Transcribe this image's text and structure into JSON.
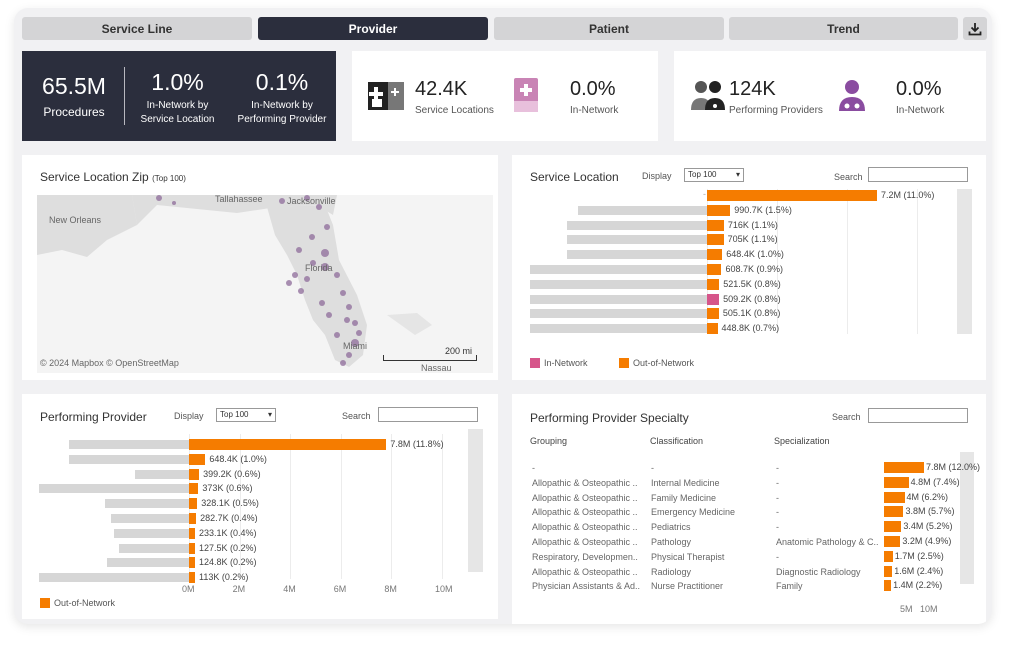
{
  "tabs": [
    {
      "label": "Service Line",
      "active": false
    },
    {
      "label": "Provider",
      "active": true
    },
    {
      "label": "Patient",
      "active": false
    },
    {
      "label": "Trend",
      "active": false
    }
  ],
  "kpi_main": {
    "procedures_value": "65.5M",
    "procedures_label": "Procedures",
    "in_network_svc_value": "1.0%",
    "in_network_svc_label1": "In-Network by",
    "in_network_svc_label2": "Service Location",
    "in_network_prov_value": "0.1%",
    "in_network_prov_label1": "In-Network by",
    "in_network_prov_label2": "Performing Provider"
  },
  "kpi_locations": {
    "value": "42.4K",
    "label": "Service Locations",
    "in_network_value": "0.0%",
    "in_network_label": "In-Network"
  },
  "kpi_providers": {
    "value": "124K",
    "label": "Performing Providers",
    "in_network_value": "0.0%",
    "in_network_label": "In-Network"
  },
  "map_panel": {
    "title": "Service Location Zip",
    "title_small": "(Top 100)",
    "labels": {
      "new_orleans": "New Orleans",
      "tallahassee": "Tallahassee",
      "jacksonville": "Jacksonville",
      "florida": "Florida",
      "miami": "Miami",
      "nassau": "Nassau"
    },
    "scale": "200 mi",
    "attribution": "© 2024 Mapbox  © OpenStreetMap"
  },
  "service_location": {
    "title": "Service Location",
    "display_label": "Display",
    "display_value": "Top 100",
    "search_label": "Search",
    "rows": [
      {
        "label": "7.2M (11.0%)",
        "gray": 0,
        "orange": 1.0,
        "in_network": false
      },
      {
        "label": "990.7K (1.5%)",
        "gray": 0.73,
        "orange": 0.137,
        "in_network": false
      },
      {
        "label": "716K (1.1%)",
        "gray": 0.79,
        "orange": 0.099,
        "in_network": false
      },
      {
        "label": "705K (1.1%)",
        "gray": 0.79,
        "orange": 0.098,
        "in_network": false
      },
      {
        "label": "648.4K (1.0%)",
        "gray": 0.79,
        "orange": 0.09,
        "in_network": false
      },
      {
        "label": "608.7K (0.9%)",
        "gray": 1.0,
        "orange": 0.085,
        "in_network": false
      },
      {
        "label": "521.5K (0.8%)",
        "gray": 1.0,
        "orange": 0.072,
        "in_network": false
      },
      {
        "label": "509.2K (0.8%)",
        "gray": 1.0,
        "orange": 0.071,
        "in_network": true
      },
      {
        "label": "505.1K (0.8%)",
        "gray": 1.0,
        "orange": 0.07,
        "in_network": false
      },
      {
        "label": "448.8K (0.7%)",
        "gray": 1.0,
        "orange": 0.062,
        "in_network": false
      }
    ],
    "legend": [
      {
        "label": "In-Network",
        "color": "#d6558a"
      },
      {
        "label": "Out-of-Network",
        "color": "#f57c00"
      }
    ]
  },
  "performing_provider": {
    "title": "Performing Provider",
    "display_label": "Display",
    "display_value": "Top 100",
    "search_label": "Search",
    "rows": [
      {
        "label": "7.8M (11.8%)",
        "value": 7.8,
        "gray": 0.8
      },
      {
        "label": "648.4K (1.0%)",
        "value": 0.6484,
        "gray": 0.8
      },
      {
        "label": "399.2K (0.6%)",
        "value": 0.3992,
        "gray": 0.36
      },
      {
        "label": "373K (0.6%)",
        "value": 0.373,
        "gray": 1.0
      },
      {
        "label": "328.1K (0.5%)",
        "value": 0.3281,
        "gray": 0.56
      },
      {
        "label": "282.7K (0.4%)",
        "value": 0.2827,
        "gray": 0.52
      },
      {
        "label": "233.1K (0.4%)",
        "value": 0.2331,
        "gray": 0.5
      },
      {
        "label": "127.5K (0.2%)",
        "value": 0.1275,
        "gray": 0.47
      },
      {
        "label": "124.8K (0.2%)",
        "value": 0.1248,
        "gray": 0.55
      },
      {
        "label": "113K (0.2%)",
        "value": 0.113,
        "gray": 1.0
      }
    ],
    "axis_ticks": [
      "0M",
      "2M",
      "4M",
      "6M",
      "8M",
      "10M"
    ],
    "axis_max": 10,
    "legend": [
      {
        "label": "Out-of-Network",
        "color": "#f57c00"
      }
    ]
  },
  "specialty": {
    "title": "Performing Provider Specialty",
    "search_label": "Search",
    "headers": {
      "grouping": "Grouping",
      "classification": "Classification",
      "specialization": "Specialization"
    },
    "rows": [
      {
        "grouping": "-",
        "classification": "-",
        "specialization": "-",
        "label": "7.8M (12.0%)",
        "value": 7.8
      },
      {
        "grouping": "Allopathic & Osteopathic ..",
        "classification": "Internal Medicine",
        "specialization": "-",
        "label": "4.8M (7.4%)",
        "value": 4.8
      },
      {
        "grouping": "Allopathic & Osteopathic ..",
        "classification": "Family Medicine",
        "specialization": "-",
        "label": "4M (6.2%)",
        "value": 4.0
      },
      {
        "grouping": "Allopathic & Osteopathic ..",
        "classification": "Emergency Medicine",
        "specialization": "-",
        "label": "3.8M (5.7%)",
        "value": 3.8
      },
      {
        "grouping": "Allopathic & Osteopathic ..",
        "classification": "Pediatrics",
        "specialization": "-",
        "label": "3.4M (5.2%)",
        "value": 3.4
      },
      {
        "grouping": "Allopathic & Osteopathic ..",
        "classification": "Pathology",
        "specialization": "Anatomic Pathology & C..",
        "label": "3.2M (4.9%)",
        "value": 3.2
      },
      {
        "grouping": "Respiratory, Developmen..",
        "classification": "Physical Therapist",
        "specialization": "-",
        "label": "1.7M (2.5%)",
        "value": 1.7
      },
      {
        "grouping": "Allopathic & Osteopathic ..",
        "classification": "Radiology",
        "specialization": "Diagnostic Radiology",
        "label": "1.6M (2.4%)",
        "value": 1.6
      },
      {
        "grouping": "Physician Assistants & Ad..",
        "classification": "Nurse Practitioner",
        "specialization": "Family",
        "label": "1.4M (2.2%)",
        "value": 1.4
      }
    ],
    "axis_ticks": [
      "5M",
      "10M"
    ]
  },
  "colors": {
    "orange": "#f57c00",
    "pink": "#d6558a",
    "navy": "#2b2e3d",
    "gray": "#d6d6d6"
  }
}
